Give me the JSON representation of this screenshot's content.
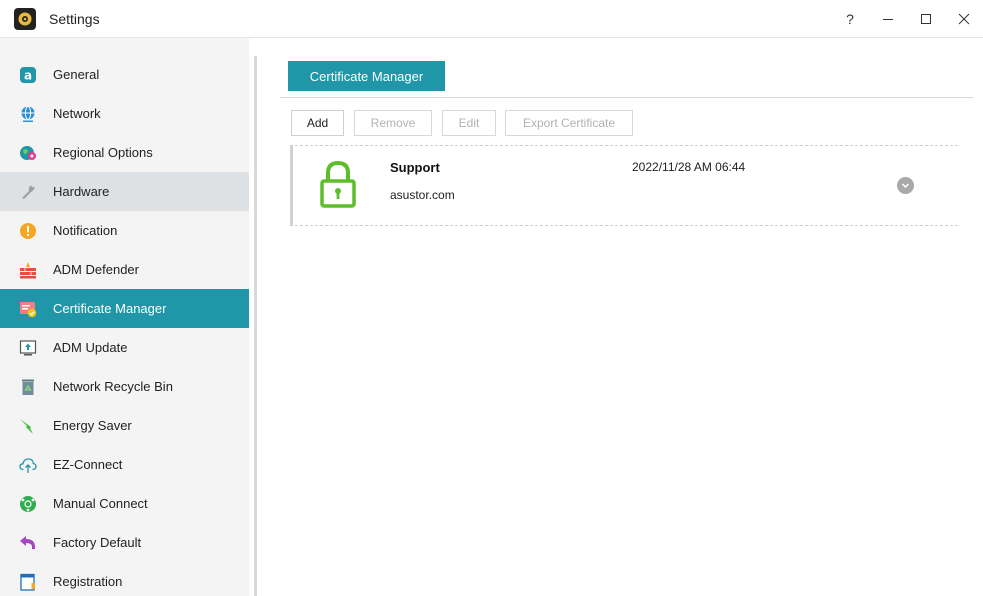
{
  "window": {
    "title": "Settings",
    "controls": {
      "help": "?",
      "minimize": "—",
      "maximize": "☐",
      "close": "✕"
    }
  },
  "sidebar": {
    "items": [
      {
        "label": "General",
        "icon": "general-icon",
        "state": "normal"
      },
      {
        "label": "Network",
        "icon": "globe-icon",
        "state": "normal"
      },
      {
        "label": "Regional Options",
        "icon": "regional-globe-icon",
        "state": "normal"
      },
      {
        "label": "Hardware",
        "icon": "wrench-icon",
        "state": "hover"
      },
      {
        "label": "Notification",
        "icon": "exclamation-icon",
        "state": "normal"
      },
      {
        "label": "ADM Defender",
        "icon": "firewall-icon",
        "state": "normal"
      },
      {
        "label": "Certificate Manager",
        "icon": "certificate-icon",
        "state": "active"
      },
      {
        "label": "ADM Update",
        "icon": "update-icon",
        "state": "normal"
      },
      {
        "label": "Network Recycle Bin",
        "icon": "recycle-bin-icon",
        "state": "normal"
      },
      {
        "label": "Energy Saver",
        "icon": "energy-icon",
        "state": "normal"
      },
      {
        "label": "EZ-Connect",
        "icon": "cloud-upload-icon",
        "state": "normal"
      },
      {
        "label": "Manual Connect",
        "icon": "connect-icon",
        "state": "normal"
      },
      {
        "label": "Factory Default",
        "icon": "undo-arrow-icon",
        "state": "normal"
      },
      {
        "label": "Registration",
        "icon": "registration-icon",
        "state": "normal"
      }
    ]
  },
  "main": {
    "tab_label": "Certificate Manager",
    "toolbar": {
      "add": "Add",
      "remove": "Remove",
      "edit": "Edit",
      "export": "Export Certificate"
    },
    "certificates": [
      {
        "name": "Support",
        "domain": "asustor.com",
        "date": "2022/11/28 AM 06:44"
      }
    ]
  },
  "colors": {
    "accent": "#1f97a8",
    "lock_green": "#5cbf2a",
    "sidebar_bg": "#f4f4f4",
    "hover_bg": "#dde1e4"
  }
}
